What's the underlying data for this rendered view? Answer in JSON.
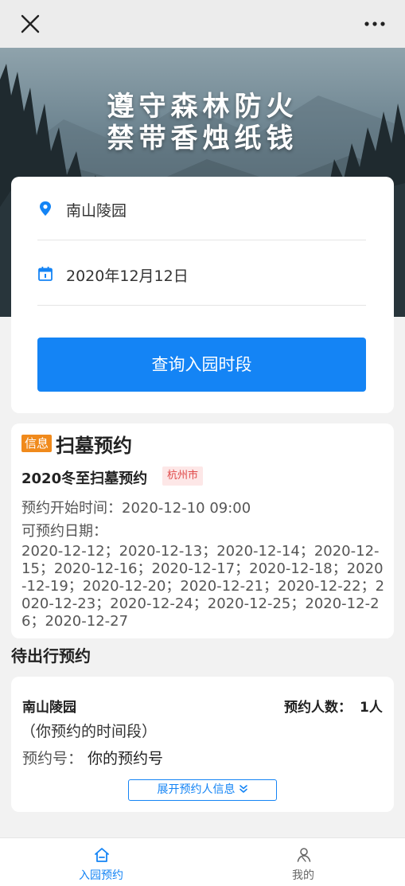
{
  "topbar": {
    "close_icon": "close-icon",
    "more_icon": "more-dots-icon"
  },
  "hero": {
    "line1": "遵守森林防火",
    "line2": "禁带香烛纸钱"
  },
  "search": {
    "location": "南山陵园",
    "date": "2020年12月12日",
    "button_label": "查询入园时段",
    "accent_color": "#1484f5"
  },
  "info": {
    "badge": "信息",
    "title": "扫墓预约",
    "event_name": "2020冬至扫墓预约",
    "city_tag": "杭州市",
    "start_time": "预约开始时间：2020-12-10 09:00",
    "date_label": "可预约日期：",
    "dates": "2020-12-12；2020-12-13；2020-12-14；2020-12-15；2020-12-16；2020-12-17；2020-12-18；2020-12-19；2020-12-20；2020-12-21；2020-12-22；2020-12-23；2020-12-24；2020-12-25；2020-12-26；2020-12-27"
  },
  "pending": {
    "section_title": "待出行预约",
    "place": "南山陵园",
    "count_label": "预约人数：",
    "count_value": "1人",
    "time_slot": "（你预约的时间段）",
    "number_label": "预约号：",
    "number_value": "你的预约号",
    "expand_label": "展开预约人信息"
  },
  "tabbar": {
    "tabs": [
      {
        "label": "入园预约",
        "icon": "home-icon",
        "active": true
      },
      {
        "label": "我的",
        "icon": "user-icon",
        "active": false
      }
    ]
  }
}
